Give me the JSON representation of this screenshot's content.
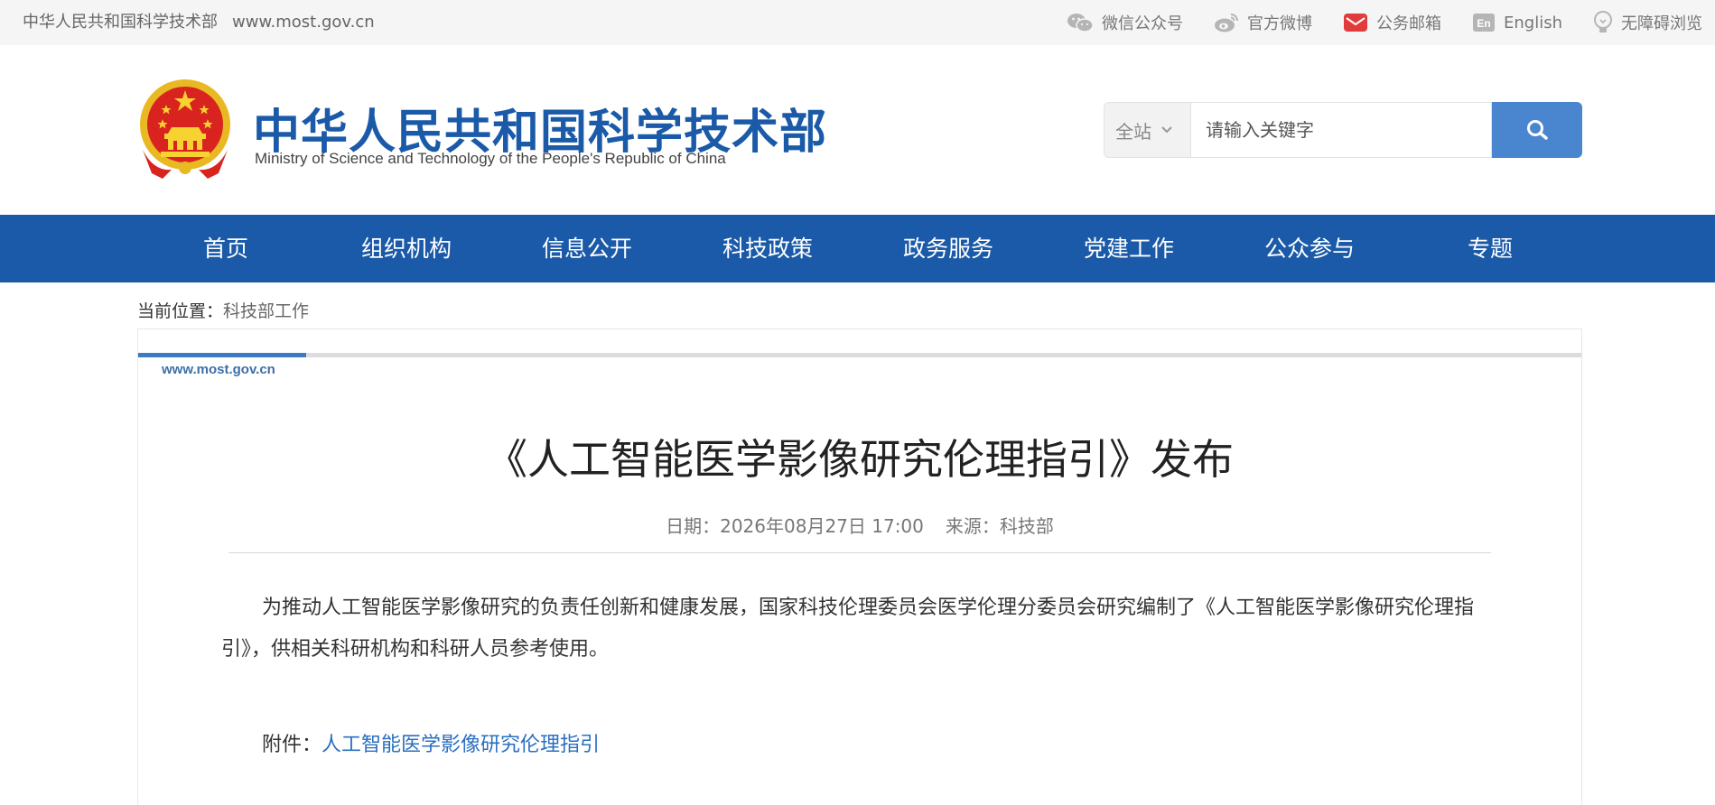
{
  "topbar": {
    "org_name": "中华人民共和国科学技术部",
    "site_url": "www.most.gov.cn",
    "links": [
      {
        "icon": "wechat-icon",
        "label": "微信公众号"
      },
      {
        "icon": "weibo-icon",
        "label": "官方微博"
      },
      {
        "icon": "mail-icon",
        "label": "公务邮箱"
      },
      {
        "icon": "english-icon",
        "label": "English"
      },
      {
        "icon": "accessibility-icon",
        "label": "无障碍浏览"
      }
    ]
  },
  "header": {
    "title": "中华人民共和国科学技术部",
    "subtitle": "Ministry of Science and Technology of the People's Republic of China"
  },
  "search": {
    "scope": "全站",
    "placeholder": "请输入关键字"
  },
  "nav": {
    "items": [
      "首页",
      "组织机构",
      "信息公开",
      "科技政策",
      "政务服务",
      "党建工作",
      "公众参与",
      "专题"
    ]
  },
  "breadcrumb": {
    "label": "当前位置：",
    "current": "科技部工作"
  },
  "article": {
    "site_url": "www.most.gov.cn",
    "title": "《人工智能医学影像研究伦理指引》发布",
    "date_label": "日期：",
    "date": "2026年08月27日 17:00",
    "source_label": "来源：",
    "source": "科技部",
    "body": "为推动人工智能医学影像研究的负责任创新和健康发展，国家科技伦理委员会医学伦理分委员会研究编制了《人工智能医学影像研究伦理指引》，供相关科研机构和科研人员参考使用。",
    "attachment_label": "附件：",
    "attachment_link": "人工智能医学影像研究伦理指引"
  },
  "colors": {
    "brand_blue": "#1a5aa8",
    "search_button": "#4a86cf",
    "link": "#2a6fc0"
  }
}
